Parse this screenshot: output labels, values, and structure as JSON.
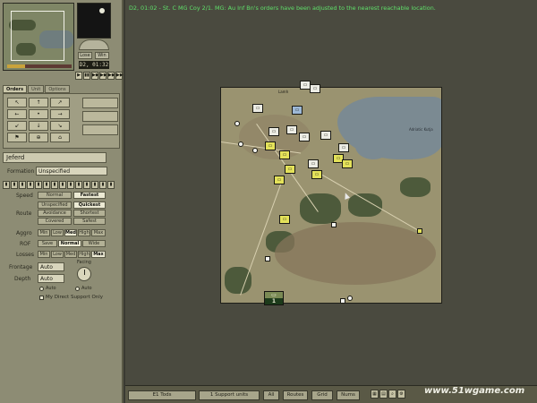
{
  "status_message": "D2, 01:02 - St. C MG Coy 2/1. MG: Au Inf Bn's orders have been adjusted to the nearest reachable location.",
  "clock": {
    "time": "D2, 01:32",
    "lose_label": "Lose",
    "win_label": "Win",
    "controls": [
      "▶",
      "▮▮",
      "▶▶",
      "▶▶",
      "▶▶",
      "▶▶"
    ]
  },
  "minimap": {
    "progress_fraction": 0.28
  },
  "tabs": [
    "Orders",
    "Unit",
    "Options"
  ],
  "orders": {
    "grid": [
      "↖",
      "↑",
      "↗",
      "←",
      "•",
      "→",
      "↙",
      "↓",
      "↘",
      "⚑",
      "⊕",
      "⌂"
    ]
  },
  "unit": {
    "name": "Jeferd",
    "formation_label": "Formation",
    "formation_value": "Unspecified",
    "icons": [
      "▮",
      "▮",
      "▮",
      "▮",
      "▮",
      "▮",
      "▮",
      "▮",
      "▮",
      "▮",
      "▮",
      "▮",
      "▮",
      "▮"
    ]
  },
  "settings": {
    "speed_label": "Speed",
    "speed_options": [
      "Normal",
      "Fastest"
    ],
    "route_label": "Route",
    "route_options": [
      "Unspecified",
      "Quickest",
      "Avoidance",
      "Shortest",
      "Covered",
      "Safest"
    ],
    "aggro_label": "Aggro",
    "aggro_options": [
      "Min",
      "Low",
      "Med",
      "High",
      "Max"
    ],
    "rof_label": "ROF",
    "rof_options": [
      "Save",
      "Normal",
      "Wide"
    ],
    "losses_label": "Losses",
    "losses_options": [
      "Min",
      "Low",
      "Med",
      "High",
      "Max"
    ],
    "frontage_label": "Frontage",
    "frontage_value": "Auto",
    "depth_label": "Depth",
    "depth_value": "Auto",
    "facing_label": "Facing",
    "auto_a": "Auto",
    "auto_b": "Auto",
    "direct_support_label": "My Direct Support Only"
  },
  "map": {
    "town_label": "Lamh",
    "lake_label": "Adriatic Kutja",
    "big_unit_top": "▭",
    "big_unit_bottom": "1"
  },
  "bottom_bar": {
    "force_label": "E1   Tods",
    "support_label": "1   Support units",
    "btn_all": "All",
    "btn_routes": "Routes",
    "btn_grid": "Grid",
    "btn_nums": "Nums"
  },
  "watermark": "www.51wgame.com"
}
